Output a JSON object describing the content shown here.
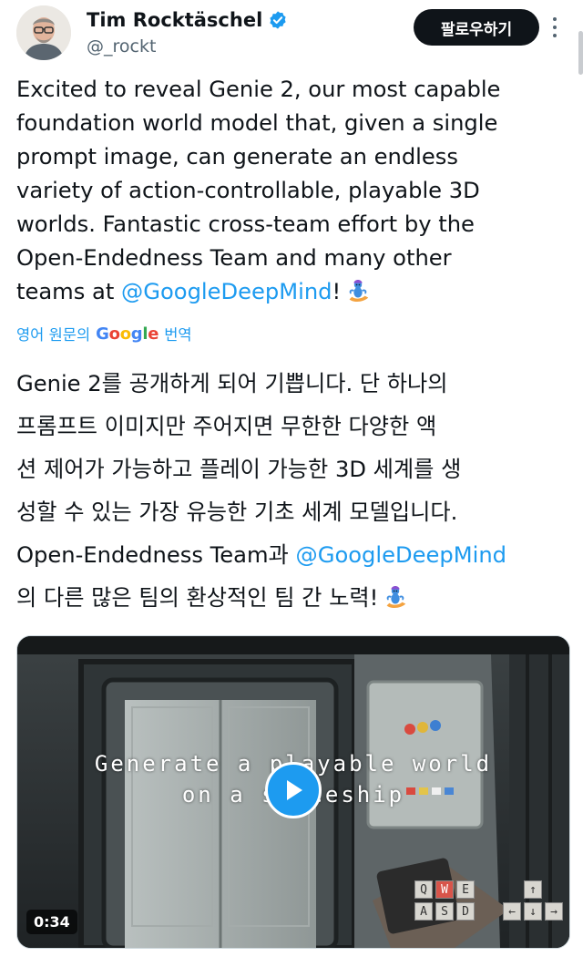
{
  "author": {
    "name": "Tim Rocktäschel",
    "handle": "@_rockt",
    "verified": true,
    "verified_icon": "verified-badge-icon"
  },
  "actions": {
    "follow_label": "팔로우하기",
    "more_icon": "more-vertical-icon"
  },
  "tweet": {
    "text_before_mention": "Excited to reveal Genie 2, our most capable\nfoundation world model that, given a single\nprompt image, can generate an endless\nvariety of action-controllable, playable 3D\nworlds. Fantastic cross-team effort by the\nOpen-Endedness Team and many other\nteams at ",
    "mention": "@GoogleDeepMind",
    "text_after_mention": "!",
    "emoji": "genie-emoji"
  },
  "translation": {
    "prefix": "영어 원문의",
    "provider": "Google",
    "suffix": "번역",
    "text_before_mention": "Genie 2를 공개하게 되어 기쁩니다. 단 하나의\n프롬프트 이미지만 주어지면 무한한 다양한 액\n션 제어가 가능하고 플레이 가능한 3D 세계를 생\n성할 수 있는 가장 유능한 기초 세계 모델입니다.\nOpen-Endedness Team과 ",
    "mention": "@GoogleDeepMind",
    "text_after_mention": "\n의 다른 많은 팀의 환상적인 팀 간 노력!"
  },
  "media": {
    "overlay_line1": "Generate a playable world",
    "overlay_line2": "on a spaceship",
    "duration": "0:34",
    "play_icon": "play-icon",
    "keys_left": [
      "Q",
      "W",
      "E",
      "A",
      "S",
      "D"
    ],
    "keys_active": [
      "W"
    ],
    "keys_right": [
      "↑",
      "←",
      "↓",
      "→"
    ]
  },
  "colors": {
    "link": "#1d9bf0",
    "text": "#0f1419",
    "secondary": "#536471",
    "follow_bg": "#0f1419"
  }
}
